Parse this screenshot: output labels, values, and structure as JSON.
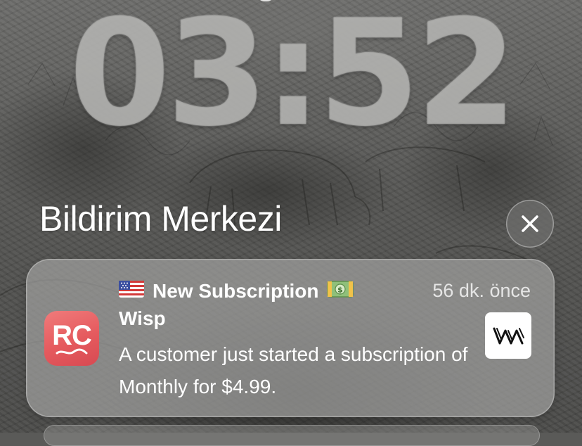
{
  "lockscreen": {
    "time": "03:52"
  },
  "notification_center": {
    "title": "Bildirim Merkezi",
    "close_icon": "close-icon"
  },
  "notification": {
    "title": "New Subscription",
    "title_prefix_icon": "us-flag-icon",
    "title_suffix_icon": "money-banknote-icon",
    "time_ago": "56 dk. önce",
    "app_name": "Wisp",
    "body": "A customer just started a subscription of Monthly for $4.99.",
    "app_icon": {
      "text": "RC",
      "color": "#e55a5e"
    },
    "attachment_icon": "wisp-logo-icon"
  }
}
